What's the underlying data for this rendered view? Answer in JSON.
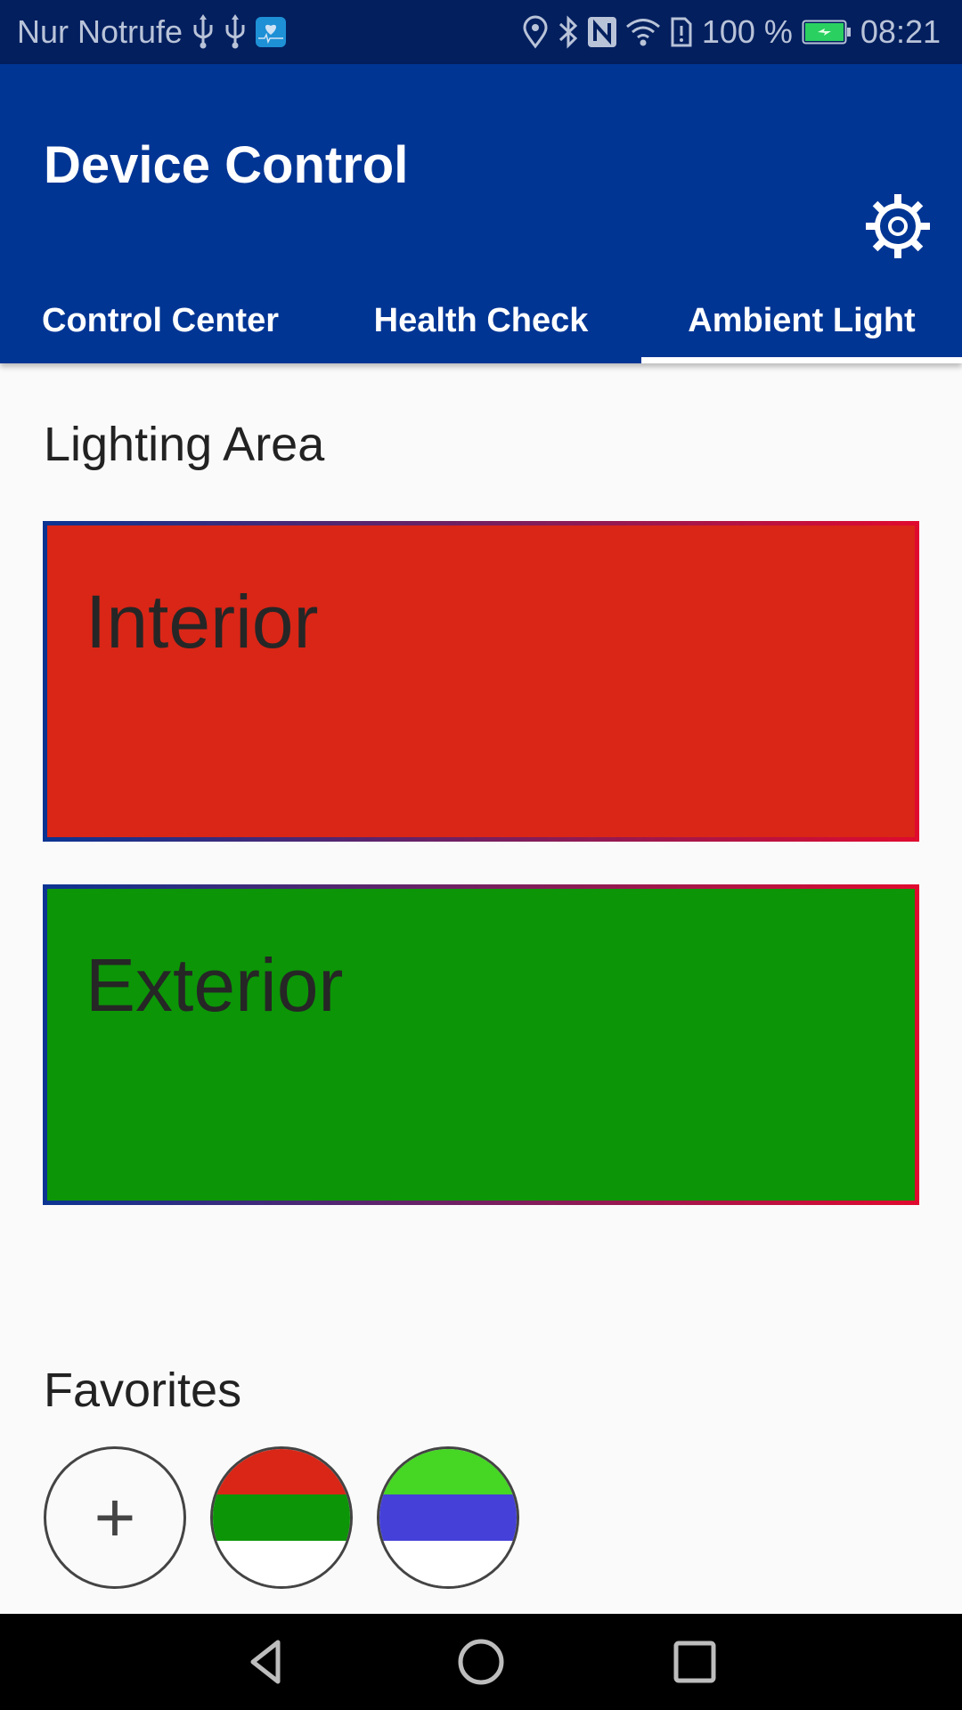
{
  "status_bar": {
    "carrier_text": "Nur Notrufe",
    "left_icons": [
      "usb-icon",
      "usb-icon",
      "health-app-icon"
    ],
    "right_icons": [
      "location-icon",
      "bluetooth-icon",
      "nfc-icon",
      "wifi-icon",
      "sim-alert-icon"
    ],
    "battery_text": "100 %",
    "battery_level_percent": 100,
    "time": "08:21"
  },
  "app_bar": {
    "title": "Device Control",
    "settings_icon": "settings-icon"
  },
  "tabs": [
    {
      "label": "Control Center",
      "active": false
    },
    {
      "label": "Health Check",
      "active": false
    },
    {
      "label": "Ambient Light",
      "active": true
    }
  ],
  "lighting": {
    "title": "Lighting Area",
    "areas": [
      {
        "label": "Interior",
        "color": "#d92617"
      },
      {
        "label": "Exterior",
        "color": "#0c9507"
      }
    ]
  },
  "favorites": {
    "title": "Favorites",
    "add_label": "+",
    "items": [
      {
        "bands": [
          "#d92617",
          "#0c9507",
          "#ffffff"
        ]
      },
      {
        "bands": [
          "#46d624",
          "#4540d8",
          "#ffffff"
        ]
      }
    ]
  },
  "colors": {
    "status_bar": "#031f5e",
    "primary": "#003594",
    "background": "#fafafa"
  },
  "nav_bar": {
    "buttons": [
      "back-icon",
      "home-icon",
      "recents-icon"
    ]
  }
}
